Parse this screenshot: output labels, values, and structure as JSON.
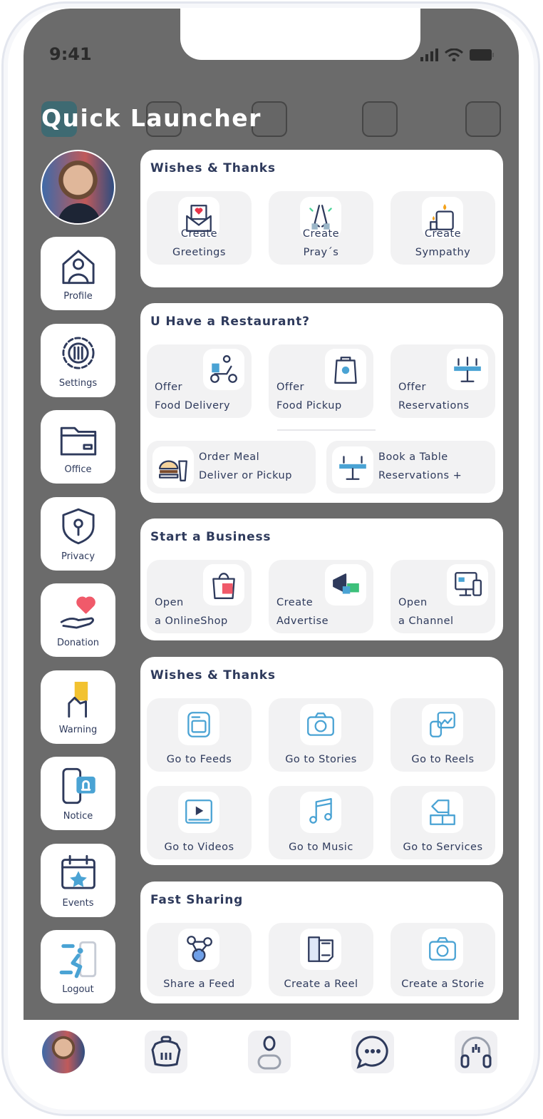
{
  "status_bar": {
    "time": "9:41"
  },
  "header": {
    "title": "Quick Launcher"
  },
  "sidebar": {
    "items": [
      {
        "label": "Profile",
        "icon": "home-user-icon"
      },
      {
        "label": "Settings",
        "icon": "gear-icon"
      },
      {
        "label": "Office",
        "icon": "folder-icon"
      },
      {
        "label": "Privacy",
        "icon": "shield-lock-icon"
      },
      {
        "label": "Donation",
        "icon": "heart-hand-icon"
      },
      {
        "label": "Warning",
        "icon": "yellow-card-icon"
      },
      {
        "label": "Notice",
        "icon": "phone-bell-icon"
      },
      {
        "label": "Events",
        "icon": "calendar-star-icon"
      },
      {
        "label": "Logout",
        "icon": "exit-door-icon"
      }
    ]
  },
  "sections": [
    {
      "title": "Wishes & Thanks",
      "tiles": [
        {
          "lines": [
            "Create",
            "Greetings"
          ],
          "icon": "greeting-card-icon"
        },
        {
          "lines": [
            "Create",
            "Pray´s"
          ],
          "icon": "praying-hands-icon"
        },
        {
          "lines": [
            "Create",
            "Sympathy"
          ],
          "icon": "candle-icon"
        }
      ]
    },
    {
      "title": "U Have a Restaurant?",
      "tiles": [
        {
          "lines": [
            "Offer",
            "Food Delivery"
          ],
          "icon": "delivery-scooter-icon"
        },
        {
          "lines": [
            "Offer",
            "Food Pickup"
          ],
          "icon": "takeaway-bag-icon"
        },
        {
          "lines": [
            "Offer",
            "Reservations"
          ],
          "icon": "reserved-table-icon"
        }
      ],
      "wide": [
        {
          "lines": [
            "Order Meal",
            "Deliver or Pickup"
          ],
          "icon": "burger-drink-icon"
        },
        {
          "lines": [
            "Book a Table",
            "Reservations +"
          ],
          "icon": "table-icon"
        }
      ]
    },
    {
      "title": "Start a Business",
      "tiles": [
        {
          "lines": [
            "Open",
            "a OnlineShop"
          ],
          "icon": "shopping-bag-icon"
        },
        {
          "lines": [
            "Create",
            "Advertise"
          ],
          "icon": "megaphone-icon"
        },
        {
          "lines": [
            "Open",
            "a Channel"
          ],
          "icon": "devices-icon"
        }
      ]
    },
    {
      "title": "Wishes & Thanks",
      "tiles": [
        {
          "lines": [
            "Go to Feeds"
          ],
          "icon": "feeds-icon"
        },
        {
          "lines": [
            "Go to Stories"
          ],
          "icon": "camera-icon"
        },
        {
          "lines": [
            "Go to Reels"
          ],
          "icon": "reels-icon"
        },
        {
          "lines": [
            "Go to Videos"
          ],
          "icon": "video-icon"
        },
        {
          "lines": [
            "Go to Music"
          ],
          "icon": "music-icon"
        },
        {
          "lines": [
            "Go to Services"
          ],
          "icon": "services-icon"
        }
      ]
    },
    {
      "title": "Fast Sharing",
      "tiles": [
        {
          "lines": [
            "Share a Feed"
          ],
          "icon": "share-network-icon"
        },
        {
          "lines": [
            "Create a Reel"
          ],
          "icon": "film-icon"
        },
        {
          "lines": [
            "Create a Storie"
          ],
          "icon": "camera-icon"
        }
      ]
    }
  ],
  "bottom_nav": [
    {
      "name": "avatar"
    },
    {
      "icon": "basket-icon"
    },
    {
      "icon": "user-icon"
    },
    {
      "icon": "chat-icon"
    },
    {
      "icon": "headphones-icon"
    }
  ],
  "colors": {
    "text": "#2e3a5c",
    "accent": "#4aa3d4",
    "overlay": "#6b6b6b",
    "tile": "#f2f2f3"
  }
}
